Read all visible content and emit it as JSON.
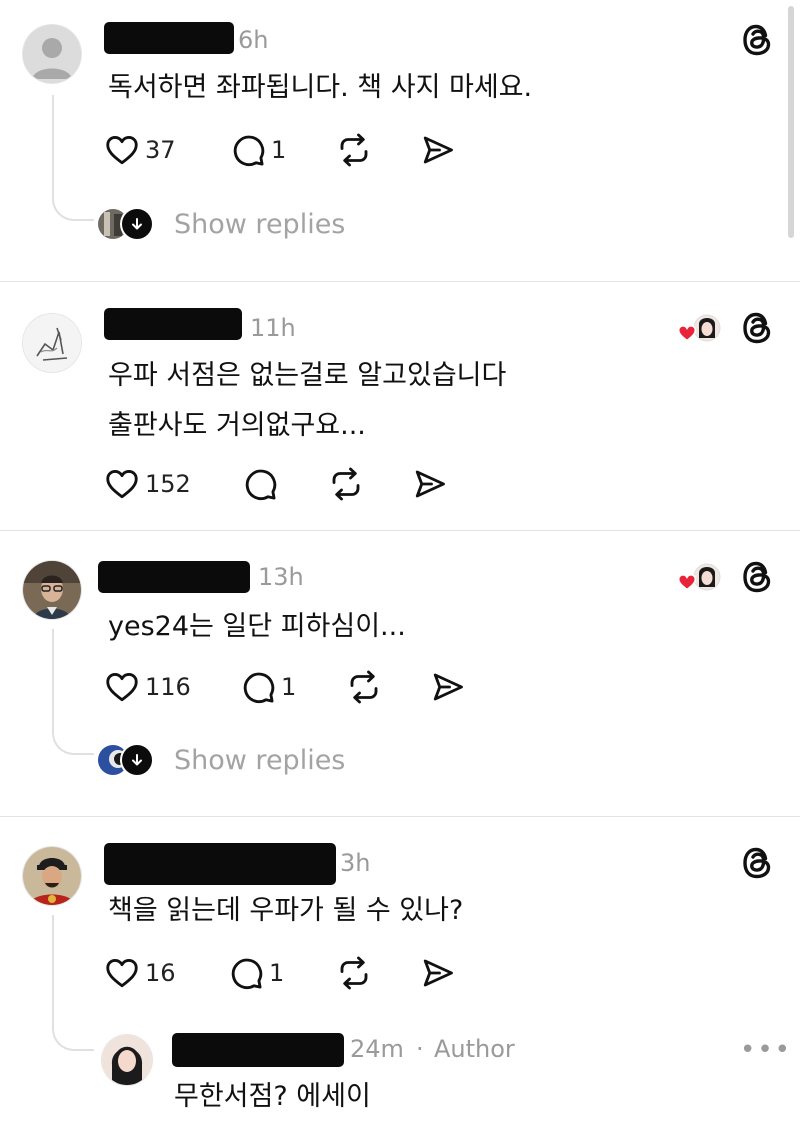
{
  "posts": [
    {
      "time": "6h",
      "text_lines": [
        "독서하면 좌파됩니다. 책 사지 마세요."
      ],
      "likes": "37",
      "replies_count": "1",
      "show_replies": "Show replies"
    },
    {
      "time": "11h",
      "text_lines": [
        "우파 서점은 없는걸로 알고있습니다",
        "출판사도 거의없구요..."
      ],
      "likes": "152"
    },
    {
      "time": "13h",
      "text_lines": [
        "yes24는 일단 피하심이..."
      ],
      "likes": "116",
      "replies_count": "1",
      "show_replies": "Show replies"
    },
    {
      "time": "3h",
      "text_lines": [
        "책을 읽는데 우파가 될 수 있나?"
      ],
      "likes": "16",
      "replies_count": "1"
    }
  ],
  "reply": {
    "time": "24m",
    "separator": "·",
    "author_badge": "Author",
    "text": "무한서점? 에세이",
    "more": "•••"
  },
  "icons": {
    "like": "heart-icon",
    "comment": "comment-icon",
    "repost": "repost-icon",
    "share": "send-icon",
    "app": "threads-logo-icon",
    "liked_by": "liked-heart-icon"
  },
  "colors": {
    "like_badge": "#e8233a",
    "muted_text": "#9a9a9a",
    "redaction": "#0b0b0b"
  }
}
